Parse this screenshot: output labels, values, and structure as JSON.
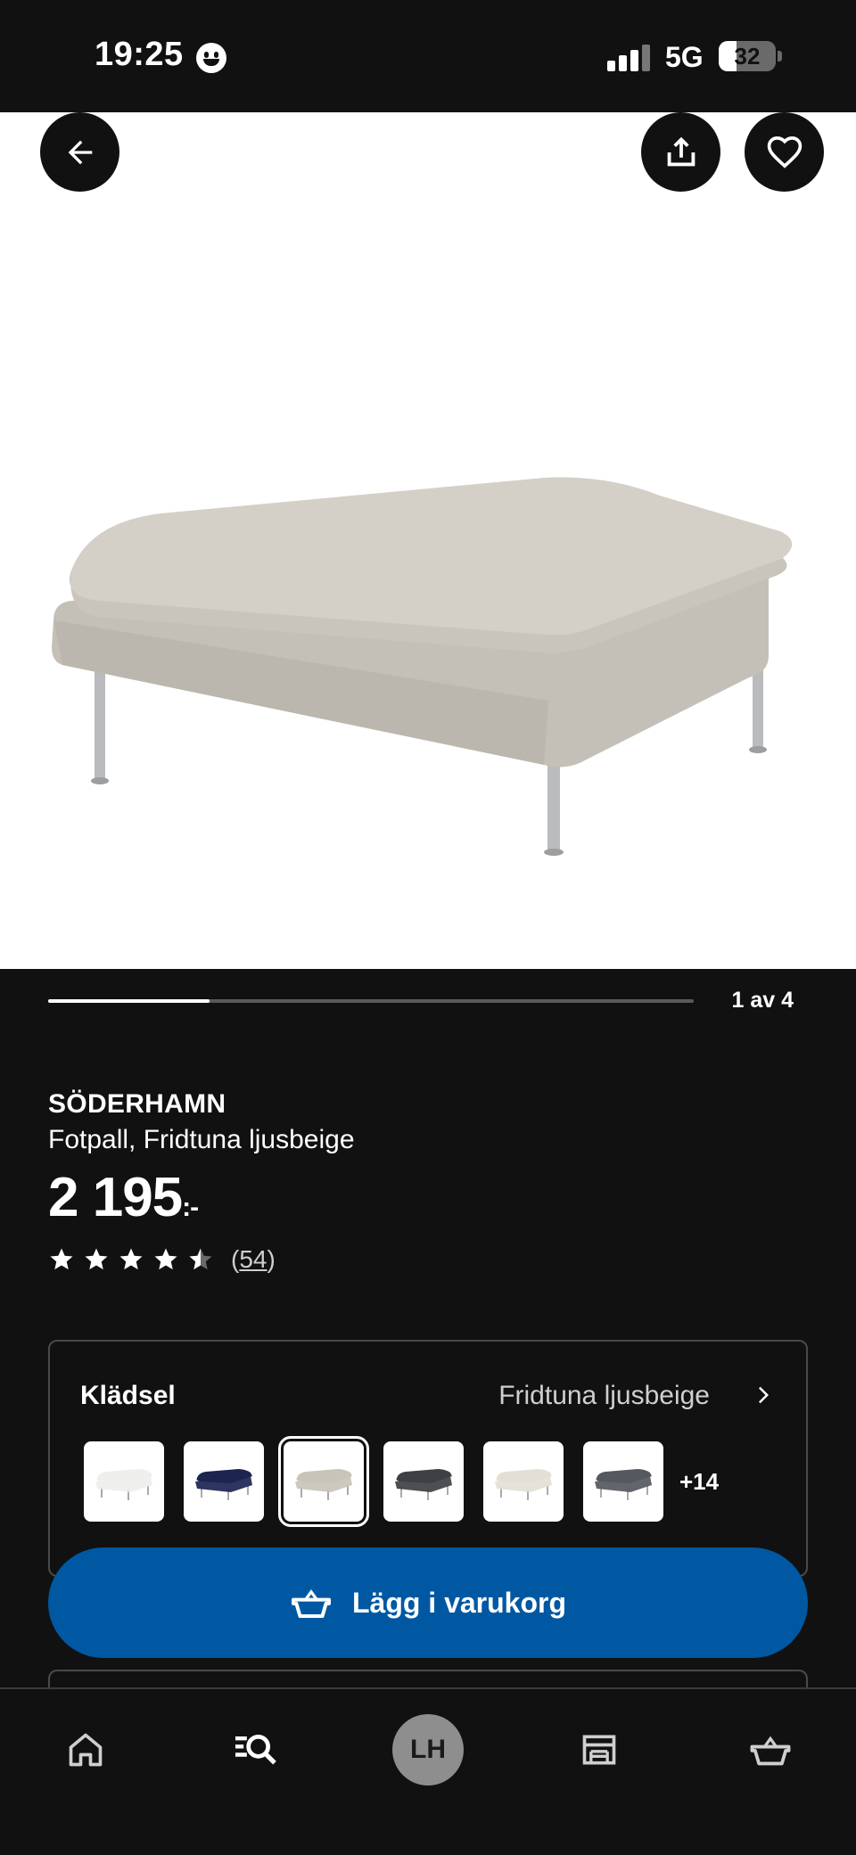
{
  "status_bar": {
    "time": "19:25",
    "network": "5G",
    "battery": "32",
    "battery_level": 0.32
  },
  "hero": {
    "back_icon": "arrow-left-icon",
    "share_icon": "share-icon",
    "favorite_icon": "heart-icon",
    "image_subject": "beige-ottoman"
  },
  "carousel": {
    "page_label": "1 av 4",
    "current": 1,
    "total": 4
  },
  "product": {
    "brand": "SÖDERHAMN",
    "subtitle": "Fotpall, Fridtuna ljusbeige",
    "price": "2 195",
    "price_suffix": ":-",
    "rating": 4.5,
    "review_count": "54",
    "review_open": "(",
    "review_close": ")"
  },
  "variant": {
    "label": "Klädsel",
    "value": "Fridtuna ljusbeige",
    "more": "+14",
    "swatches": [
      {
        "color": "#eeeeec",
        "selected": false
      },
      {
        "color": "#1c2450",
        "selected": false
      },
      {
        "color": "#c9c4b8",
        "selected": true
      },
      {
        "color": "#3f4043",
        "selected": false
      },
      {
        "color": "#e3dfd6",
        "selected": false
      },
      {
        "color": "#55585f",
        "selected": false
      }
    ]
  },
  "cart_button": {
    "label": "Lägg i varukorg",
    "icon": "basket-icon",
    "color": "#0058a3"
  },
  "bottom_nav": {
    "items": [
      {
        "icon": "home-icon"
      },
      {
        "icon": "search-list-icon"
      },
      {
        "icon": "avatar",
        "initials": "LH"
      },
      {
        "icon": "store-icon"
      },
      {
        "icon": "basket-icon"
      }
    ]
  }
}
